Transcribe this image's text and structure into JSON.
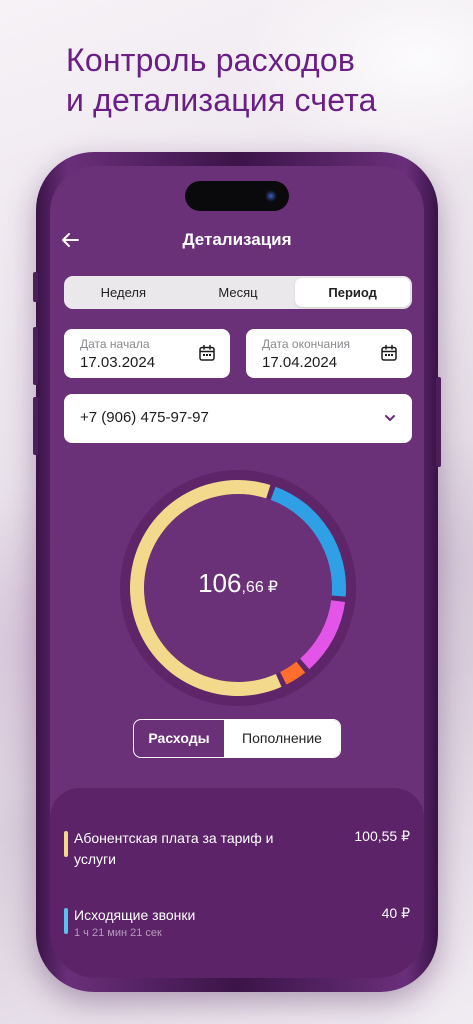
{
  "promo": {
    "line1": "Контроль расходов",
    "line2": "и детализация счета"
  },
  "header": {
    "title": "Детализация",
    "back_icon": "arrow-left-icon"
  },
  "period_tabs": [
    {
      "label": "Неделя",
      "active": false
    },
    {
      "label": "Месяц",
      "active": false
    },
    {
      "label": "Период",
      "active": true
    }
  ],
  "date_start": {
    "label": "Дата начала",
    "value": "17.03.2024",
    "icon": "calendar-icon"
  },
  "date_end": {
    "label": "Дата окончания",
    "value": "17.04.2024",
    "icon": "calendar-icon"
  },
  "phone_select": {
    "value": "+7 (906) 475-97-97",
    "icon": "chevron-down-icon"
  },
  "donut": {
    "total_int": "106",
    "total_frac": ",66",
    "currency": "₽"
  },
  "toggle": {
    "expenses": "Расходы",
    "topup": "Пополнение"
  },
  "items": [
    {
      "name": "Абонентская плата за тариф и услуги",
      "sub": "",
      "amount": "100,55 ₽",
      "color": "#f3d98c"
    },
    {
      "name": "Исходящие звонки",
      "sub": "1 ч 21 мин 21 сек",
      "amount": "40 ₽",
      "color": "#59c3f0"
    }
  ],
  "chart_data": {
    "type": "pie",
    "categories": [
      "Абонентская плата за тариф и услуги",
      "Исходящие звонки",
      "pink",
      "orange"
    ],
    "values": [
      0.61,
      0.21,
      0.12,
      0.04
    ],
    "colors": [
      "#f3d98c",
      "#2f9fe6",
      "#e354e8",
      "#ff6e2a"
    ]
  }
}
